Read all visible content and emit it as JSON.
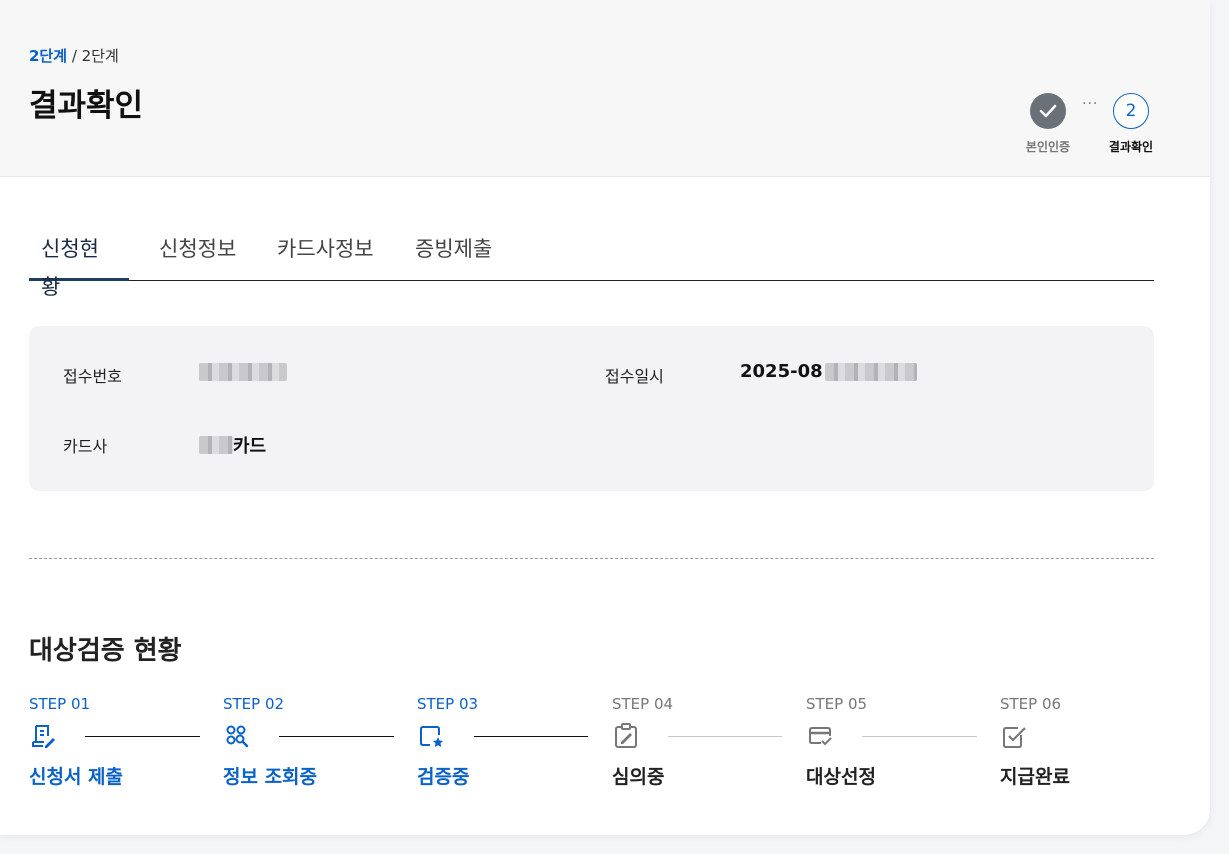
{
  "breadcrumb": {
    "current": "2단계",
    "separator": " / ",
    "total": "2단계"
  },
  "page_title": "결과확인",
  "progress": {
    "steps": [
      {
        "label": "본인인증",
        "state": "done"
      },
      {
        "label": "결과확인",
        "number": "2",
        "state": "current"
      }
    ],
    "separator": "···"
  },
  "tabs": [
    {
      "label": "신청현황",
      "active": true
    },
    {
      "label": "신청정보",
      "active": false
    },
    {
      "label": "카드사정보",
      "active": false
    },
    {
      "label": "증빙제출",
      "active": false
    }
  ],
  "info": {
    "receipt_no_label": "접수번호",
    "receipt_date_label": "접수일시",
    "receipt_date_visible": "2025-08",
    "card_company_label": "카드사",
    "card_company_suffix": "카드"
  },
  "verification": {
    "title": "대상검증 현황",
    "steps": [
      {
        "step": "STEP 01",
        "name": "신청서 제출",
        "icon": "document-pen-icon",
        "state": "completed"
      },
      {
        "step": "STEP 02",
        "name": "정보 조회중",
        "icon": "search-circles-icon",
        "state": "completed"
      },
      {
        "step": "STEP 03",
        "name": "검증중",
        "icon": "screen-star-icon",
        "state": "completed"
      },
      {
        "step": "STEP 04",
        "name": "심의중",
        "icon": "clipboard-edit-icon",
        "state": "pending"
      },
      {
        "step": "STEP 05",
        "name": "대상선정",
        "icon": "card-check-icon",
        "state": "pending"
      },
      {
        "step": "STEP 06",
        "name": "지급완료",
        "icon": "checkbox-icon",
        "state": "pending"
      }
    ]
  },
  "colors": {
    "accent": "#0a62c9",
    "pending": "#777777",
    "done_circle": "#6b7178"
  }
}
